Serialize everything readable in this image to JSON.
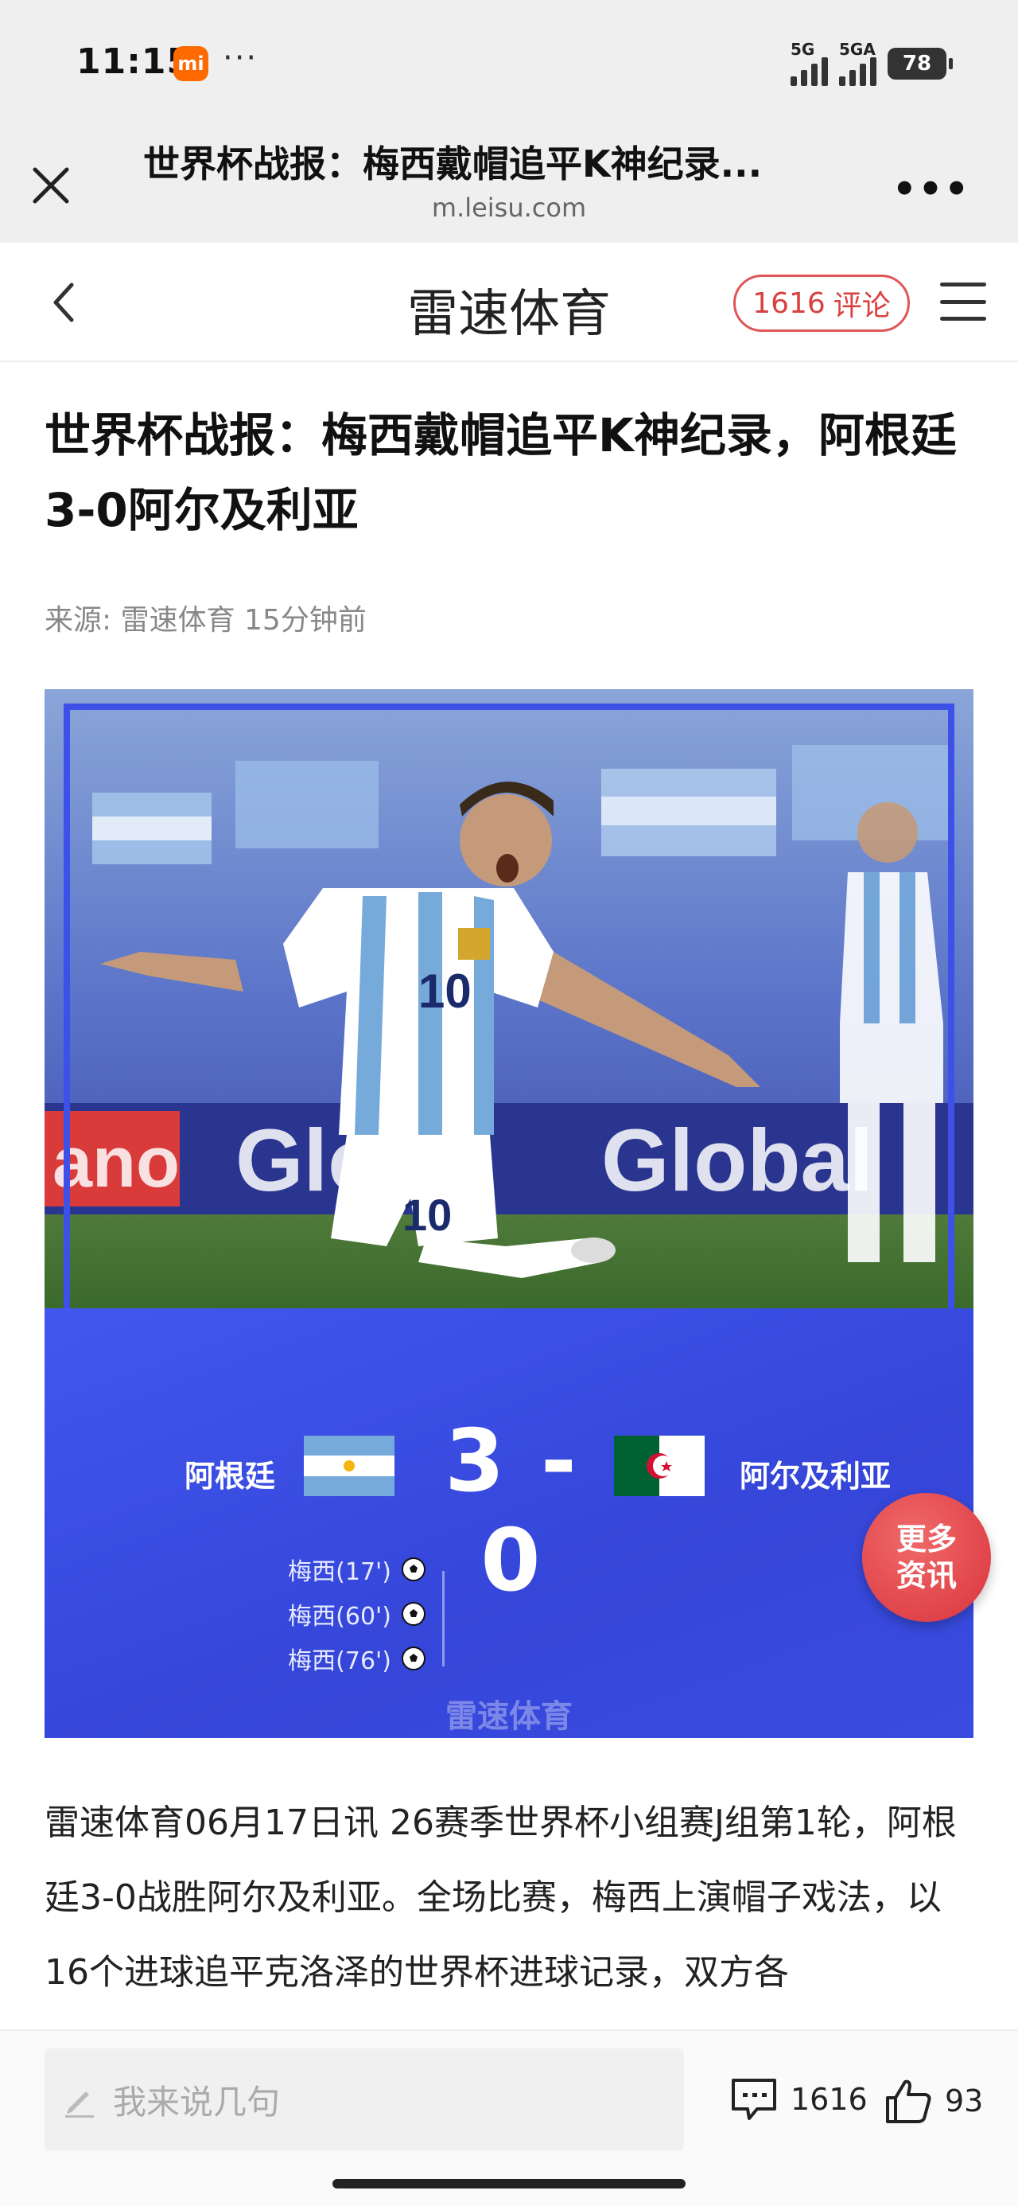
{
  "status_bar": {
    "time": "11:15",
    "mi_label": "mi",
    "more": "···",
    "signal1": "5G",
    "signal2": "5GA",
    "battery": "78"
  },
  "browser": {
    "page_title": "世界杯战报：梅西戴帽追平K神纪录...",
    "url": "m.leisu.com"
  },
  "site_nav": {
    "site_name": "雷速体育",
    "comment_count": "1616",
    "comment_label": "评论"
  },
  "article": {
    "headline": "世界杯战报：梅西戴帽追平K神纪录，阿根廷3-0阿尔及利亚",
    "meta": "来源: 雷速体育 15分钟前",
    "body": "雷速体育06月17日讯 26赛季世界杯小组赛J组第1轮，阿根廷3-0战胜阿尔及利亚。全场比赛，梅西上演帽子戏法，以16个进球追平克洛泽的世界杯进球记录，双方各"
  },
  "score_card": {
    "home_team": "阿根廷",
    "away_team": "阿尔及利亚",
    "score": "3 - 0",
    "scorers": [
      "梅西(17')",
      "梅西(60')",
      "梅西(76')"
    ],
    "watermark": "雷速体育",
    "photo_banner_1": "Globa",
    "photo_banner_2": "Global",
    "photo_banner_left": "ano"
  },
  "more_news": {
    "label_line1": "更多",
    "label_line2": "资讯"
  },
  "bottom_bar": {
    "comment_placeholder": "我来说几句",
    "comment_count": "1616",
    "like_count": "93"
  },
  "colors": {
    "accent_red": "#d94040",
    "panel_blue": "#3a4ce0",
    "arg_sky": "#75aadb",
    "alg_green": "#006233",
    "alg_red": "#d21034"
  },
  "icons": [
    "close-icon",
    "more-dots-icon",
    "back-chevron-icon",
    "menu-icon",
    "pencil-icon",
    "comment-icon",
    "thumbs-up-icon",
    "soccer-ball-icon"
  ]
}
